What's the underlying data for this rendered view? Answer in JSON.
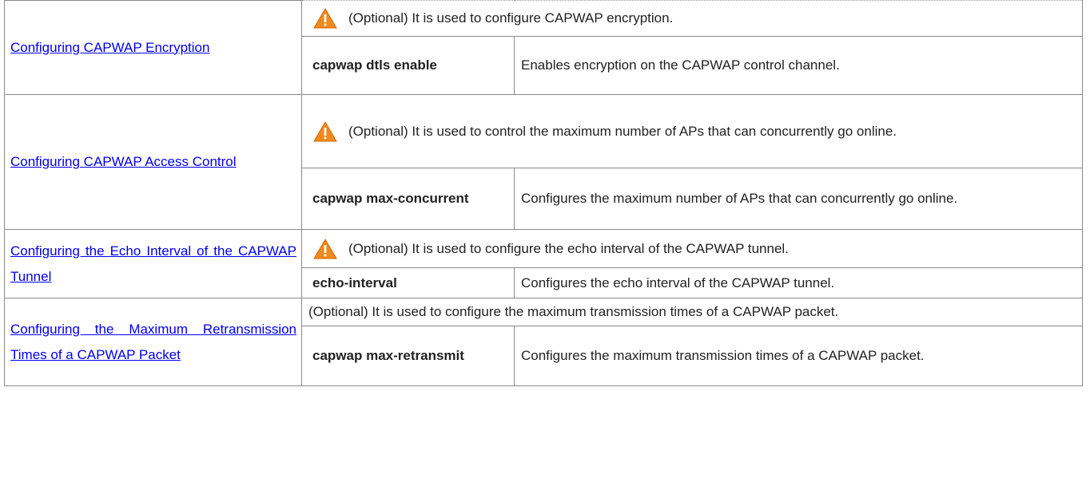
{
  "rows": [
    {
      "task": "Configuring CAPWAP Encryption",
      "note": "(Optional) It is used to configure CAPWAP encryption.",
      "command": "capwap dtls enable",
      "description": "Enables encryption on the CAPWAP control channel."
    },
    {
      "task": "Configuring CAPWAP Access Control",
      "note": "(Optional) It is used to control the maximum number of APs that can concurrently go online.",
      "command": "capwap max-concurrent",
      "description": "Configures the maximum number of APs that can concurrently go online."
    },
    {
      "task": "Configuring the Echo Interval of the CAPWAP Tunnel",
      "note": "(Optional) It is used to configure the echo interval of the CAPWAP tunnel.",
      "command": "echo-interval",
      "description": "Configures the echo interval of the CAPWAP tunnel."
    },
    {
      "task": "Configuring the Maximum Retransmission Times of a CAPWAP Packet",
      "note": "(Optional) It is used to configure the maximum transmission times of a CAPWAP packet.",
      "command": "capwap max-retransmit",
      "description": "Configures the maximum transmission times of a CAPWAP packet."
    }
  ],
  "colors": {
    "link": "#0000ee",
    "warning_fill": "#f08a1c",
    "border": "#8a8a8a"
  },
  "icons": {
    "warning": "warning-triangle-icon"
  }
}
